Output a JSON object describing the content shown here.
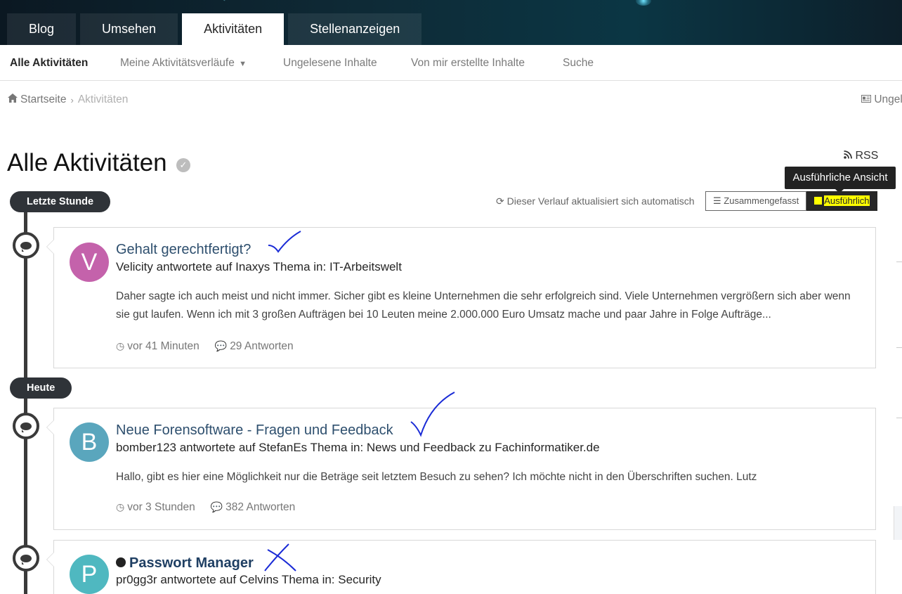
{
  "top_tabs": [
    {
      "label": "Blog",
      "active": false
    },
    {
      "label": "Umsehen",
      "active": false
    },
    {
      "label": "Aktivitäten",
      "active": true
    },
    {
      "label": "Stellenanzeigen",
      "active": false
    }
  ],
  "sub_nav": {
    "all": "Alle Aktivitäten",
    "my_streams": "Meine Aktivitätsverläufe",
    "unread": "Ungelesene Inhalte",
    "mine": "Von mir erstellte Inhalte",
    "search": "Suche"
  },
  "breadcrumb": {
    "home": "Startseite",
    "current": "Aktivitäten",
    "right_link": "Ungele"
  },
  "page": {
    "title": "Alle Aktivitäten",
    "rss": "RSS",
    "auto_update": "Dieser Verlauf aktualisiert sich automatisch",
    "view_condensed": "Zusammengefasst",
    "view_expanded": "Ausführlich",
    "tooltip": "Ausführliche Ansicht"
  },
  "timeline": [
    {
      "group": "Letzte Stunde"
    },
    {
      "group": "Heute"
    }
  ],
  "items": [
    {
      "avatar_letter": "V",
      "avatar_color": "#c462ab",
      "title": "Gehalt gerechtfertigt?",
      "meta": "Velicity antwortete auf Inaxys Thema in: IT-Arbeitswelt",
      "excerpt": "Daher sagte ich auch meist und nicht immer. Sicher gibt es kleine Unternehmen die sehr erfolgreich sind. Viele Unternehmen vergrößern sich aber wenn sie gut laufen. Wenn ich mit 3 großen Aufträgen bei 10 Leuten meine 2.000.000 Euro Umsatz mache und paar Jahre in Folge Aufträge...",
      "time": "vor 41 Minuten",
      "replies": "29 Antworten",
      "annotation": "check"
    },
    {
      "avatar_letter": "B",
      "avatar_color": "#5aa6bd",
      "title": "Neue Forensoftware - Fragen und Feedback",
      "meta": "bomber123 antwortete auf StefanEs Thema in: News und Feedback zu Fachinformatiker.de",
      "excerpt": "Hallo, gibt es hier eine Möglichkeit nur die Beträge seit letztem Besuch zu sehen? Ich möchte nicht in den Überschriften suchen. Lutz",
      "time": "vor 3 Stunden",
      "replies": "382 Antworten",
      "annotation": "check"
    },
    {
      "avatar_letter": "P",
      "avatar_color": "#4fb8c0",
      "title": "Passwort Manager",
      "meta": "pr0gg3r antwortete auf Celvins Thema in: Security",
      "unread": true,
      "annotation": "cross"
    }
  ],
  "colors": {
    "topbar": "#0e2a36",
    "link": "#2e4f6e",
    "annotation_ink": "#1a2bd6",
    "highlight": "#ffff00"
  }
}
